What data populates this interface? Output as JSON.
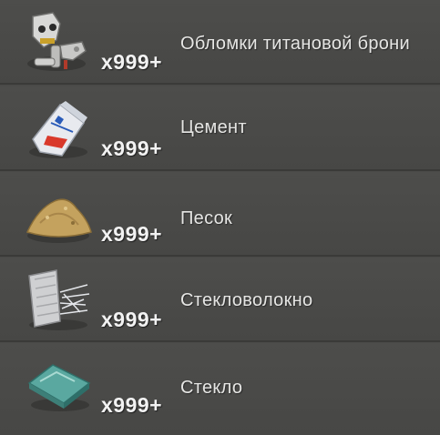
{
  "items": [
    {
      "name": "Обломки титановой брони",
      "qty": "x999+",
      "icon": "titanium-armor-fragments-icon"
    },
    {
      "name": "Цемент",
      "qty": "x999+",
      "icon": "cement-bag-icon"
    },
    {
      "name": "Песок",
      "qty": "x999+",
      "icon": "sand-pile-icon"
    },
    {
      "name": "Стекловолокно",
      "qty": "x999+",
      "icon": "fiberglass-icon"
    },
    {
      "name": "Стекло",
      "qty": "x999+",
      "icon": "glass-icon"
    }
  ]
}
